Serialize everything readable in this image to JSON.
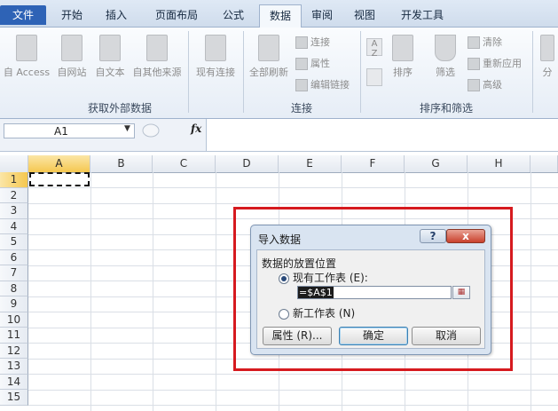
{
  "tabs": [
    {
      "label": "文件",
      "kind": "file"
    },
    {
      "label": "开始"
    },
    {
      "label": "插入"
    },
    {
      "label": "页面布局"
    },
    {
      "label": "公式"
    },
    {
      "label": "数据",
      "active": true
    },
    {
      "label": "审阅"
    },
    {
      "label": "视图"
    },
    {
      "label": "开发工具"
    }
  ],
  "ribbon": {
    "get_external": {
      "label": "获取外部数据",
      "buttons": [
        "自 Access",
        "自网站",
        "自文本",
        "自其他来源",
        "现有连接"
      ]
    },
    "connections": {
      "label": "连接",
      "refresh_all": "全部刷新",
      "items": [
        "连接",
        "属性",
        "编辑链接"
      ]
    },
    "sort_filter": {
      "label": "排序和筛选",
      "az": "A\nZ",
      "sort": "排序",
      "filter": "筛选",
      "items": [
        "清除",
        "重新应用",
        "高级"
      ],
      "cut_label": "分"
    }
  },
  "formula_bar": {
    "name_box": "A1",
    "fx": "fx",
    "formula": ""
  },
  "grid": {
    "columns": [
      "A",
      "B",
      "C",
      "D",
      "E",
      "F",
      "G",
      "H"
    ],
    "rows": [
      "1",
      "2",
      "3",
      "4",
      "5",
      "6",
      "7",
      "8",
      "9",
      "10",
      "11",
      "12",
      "13",
      "14",
      "15"
    ],
    "selected_col": "A",
    "selected_row": "1"
  },
  "dialog": {
    "title": "导入数据",
    "help": "?",
    "close": "x",
    "section": "数据的放置位置",
    "option_existing": "现有工作表 (E):",
    "option_new": "新工作表 (N)",
    "reference": "=$A$1",
    "btn_properties": "属性 (R)...",
    "btn_ok": "确定",
    "btn_cancel": "取消"
  }
}
